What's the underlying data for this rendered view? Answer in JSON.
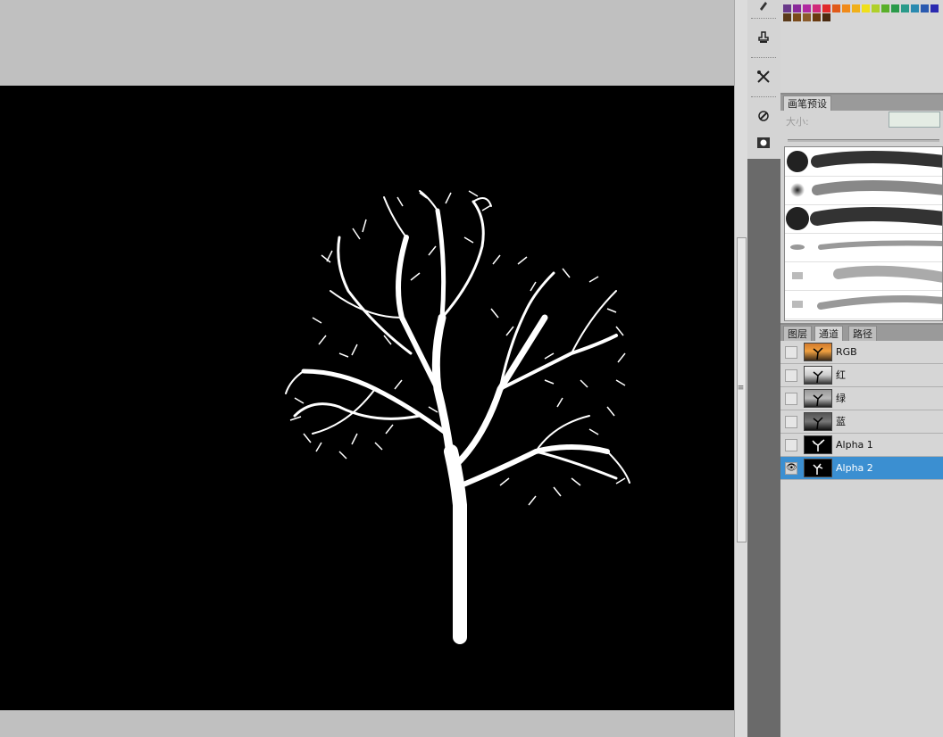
{
  "brush_panel": {
    "tab": "画笔预设",
    "size_label": "大小:"
  },
  "channels_panel": {
    "tabs": [
      "图层",
      "通道",
      "路径"
    ],
    "active_tab": "通道",
    "channels": [
      {
        "name": "RGB",
        "visible": false,
        "selected": false
      },
      {
        "name": "红",
        "visible": false,
        "selected": false
      },
      {
        "name": "绿",
        "visible": false,
        "selected": false
      },
      {
        "name": "蓝",
        "visible": false,
        "selected": false
      },
      {
        "name": "Alpha 1",
        "visible": false,
        "selected": false
      },
      {
        "name": "Alpha 2",
        "visible": true,
        "selected": true
      }
    ]
  },
  "tools": [
    "brush-icon",
    "stamp-icon",
    "crossed-tools-icon",
    "dodge-icon",
    "mask-mode-icon"
  ],
  "colors": {
    "selection": "#3b8fd1",
    "canvas": "#000000",
    "panel_bg": "#d4d4d4"
  }
}
